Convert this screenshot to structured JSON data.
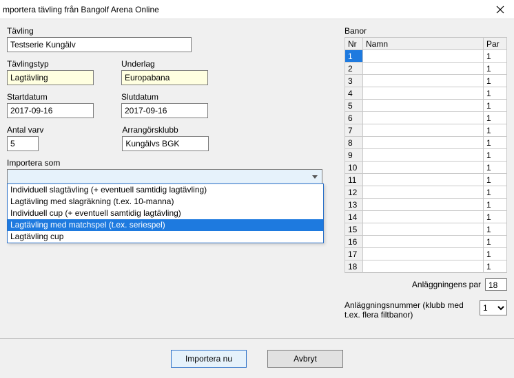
{
  "window": {
    "title": "mportera tävling från Bangolf Arena Online"
  },
  "left": {
    "tavling_label": "Tävling",
    "tavling_value": "Testserie Kungälv",
    "tavlingstyp_label": "Tävlingstyp",
    "tavlingstyp_value": "Lagtävling",
    "underlag_label": "Underlag",
    "underlag_value": "Europabana",
    "startdatum_label": "Startdatum",
    "startdatum_value": "2017-09-16",
    "slutdatum_label": "Slutdatum",
    "slutdatum_value": "2017-09-16",
    "antalvarv_label": "Antal varv",
    "antalvarv_value": "5",
    "arrangorsklubb_label": "Arrangörsklubb",
    "arrangorsklubb_value": "Kungälvs BGK",
    "importera_som_label": "Importera som",
    "dropdown_options": [
      "Individuell slagtävling (+ eventuell samtidig lagtävling)",
      "Lagtävling med slagräkning (t.ex. 10-manna)",
      "Individuell cup (+ eventuell samtidig lagtävling)",
      "Lagtävling med matchspel (t.ex. seriespel)",
      "Lagtävling cup"
    ],
    "dropdown_selected_index": 3
  },
  "right": {
    "banor_label": "Banor",
    "col_nr": "Nr",
    "col_name": "Namn",
    "col_par": "Par",
    "rows": [
      {
        "nr": "1",
        "namn": "",
        "par": "1",
        "selected": true
      },
      {
        "nr": "2",
        "namn": "",
        "par": "1"
      },
      {
        "nr": "3",
        "namn": "",
        "par": "1"
      },
      {
        "nr": "4",
        "namn": "",
        "par": "1"
      },
      {
        "nr": "5",
        "namn": "",
        "par": "1"
      },
      {
        "nr": "6",
        "namn": "",
        "par": "1"
      },
      {
        "nr": "7",
        "namn": "",
        "par": "1"
      },
      {
        "nr": "8",
        "namn": "",
        "par": "1"
      },
      {
        "nr": "9",
        "namn": "",
        "par": "1"
      },
      {
        "nr": "10",
        "namn": "",
        "par": "1"
      },
      {
        "nr": "11",
        "namn": "",
        "par": "1"
      },
      {
        "nr": "12",
        "namn": "",
        "par": "1"
      },
      {
        "nr": "13",
        "namn": "",
        "par": "1"
      },
      {
        "nr": "14",
        "namn": "",
        "par": "1"
      },
      {
        "nr": "15",
        "namn": "",
        "par": "1"
      },
      {
        "nr": "16",
        "namn": "",
        "par": "1"
      },
      {
        "nr": "17",
        "namn": "",
        "par": "1"
      },
      {
        "nr": "18",
        "namn": "",
        "par": "1"
      }
    ],
    "anlaggningens_par_label": "Anläggningens par",
    "anlaggningens_par_value": "18",
    "anlaggningsnummer_label": "Anläggningsnummer (klubb med t.ex. flera filtbanor)",
    "anlaggningsnummer_value": "1"
  },
  "footer": {
    "importera_nu": "Importera nu",
    "avbryt": "Avbryt"
  }
}
